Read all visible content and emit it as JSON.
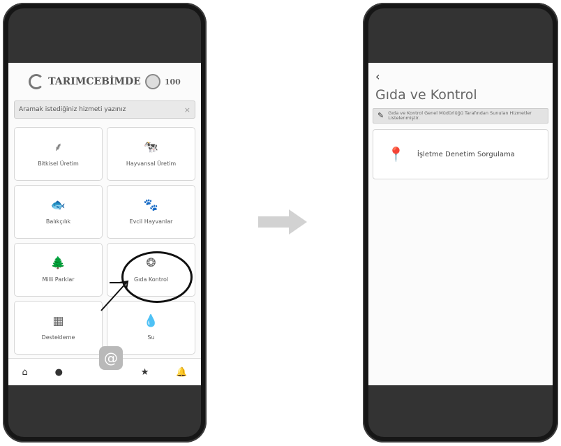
{
  "left": {
    "logo_text": "TARIMCEBİMDE",
    "logo_badge": "100",
    "search_placeholder": "Aramak istediğiniz hizmeti yazınız",
    "search_clear": "×",
    "tiles": [
      {
        "label": "Bitkisel Üretim",
        "icon": "wheat-icon",
        "glyph": "⸙"
      },
      {
        "label": "Hayvansal Üretim",
        "icon": "cow-icon",
        "glyph": "🐄"
      },
      {
        "label": "Balıkçılık",
        "icon": "fish-icon",
        "glyph": "🐟"
      },
      {
        "label": "Evcil Hayvanlar",
        "icon": "pets-icon",
        "glyph": "🐾"
      },
      {
        "label": "Milli Parklar",
        "icon": "trees-icon",
        "glyph": "🌲"
      },
      {
        "label": "Gıda Kontrol",
        "icon": "food-control-icon",
        "glyph": "❂"
      },
      {
        "label": "Destekleme",
        "icon": "support-icon",
        "glyph": "▦"
      },
      {
        "label": "Su",
        "icon": "water-drop-icon",
        "glyph": "💧"
      }
    ],
    "tabbar": [
      {
        "icon": "home-icon",
        "glyph": "⌂"
      },
      {
        "icon": "user-icon",
        "glyph": "●"
      },
      {
        "icon": "star-icon",
        "glyph": "★"
      },
      {
        "icon": "bell-icon",
        "glyph": "🔔"
      }
    ],
    "fab_glyph": "@"
  },
  "right": {
    "back_glyph": "‹",
    "title": "Gıda ve Kontrol",
    "info_text": "Gıda ve Kontrol Genel Müdürlüğü Tarafından Sunulan Hizmetler Listelenmiştir.",
    "card_label": "İşletme Denetim Sorgulama",
    "card_icon_glyph": "📍"
  },
  "colors": {
    "frame": "#161616",
    "band": "#333333",
    "screen": "#fbfbfb",
    "arrow": "#cfcfcf"
  }
}
